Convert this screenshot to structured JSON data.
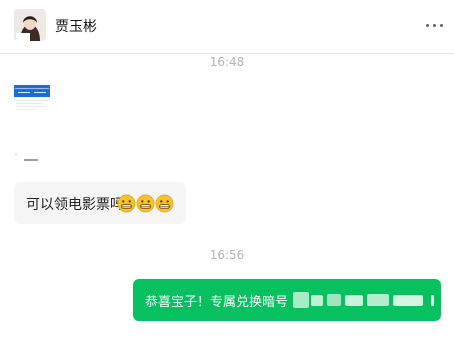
{
  "header": {
    "contact_name": "贾玉彬",
    "more_icon": "more-horizontal-icon"
  },
  "messages": {
    "time_1": "16:48",
    "received_image": "image-attachment",
    "received_text": "可以领电影票吗",
    "emoji_count": 3,
    "time_2": "16:56",
    "sent_text": "恭喜宝子！专属兑换暗号"
  },
  "colors": {
    "sent_bubble": "#07c160",
    "received_bubble": "#f5f5f6",
    "timestamp": "#b3b3b3"
  }
}
